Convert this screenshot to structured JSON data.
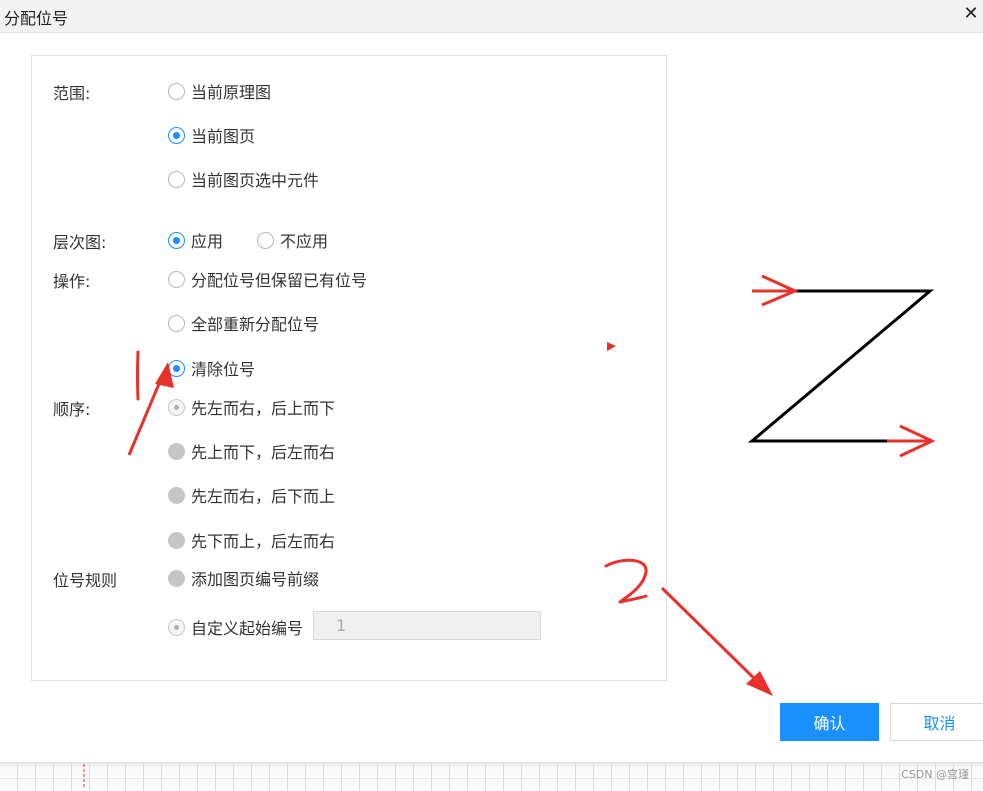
{
  "dialog": {
    "title": "分配位号",
    "close_glyph": "✕"
  },
  "scope": {
    "label": "范围:",
    "options": [
      "当前原理图",
      "当前图页",
      "当前图页选中元件"
    ],
    "selected": 1
  },
  "hierarchy": {
    "label": "层次图:",
    "options": [
      "应用",
      "不应用"
    ],
    "selected": 0
  },
  "operation": {
    "label": "操作:",
    "options": [
      "分配位号但保留已有位号",
      "全部重新分配位号",
      "清除位号"
    ],
    "selected": 2
  },
  "order": {
    "label": "顺序:",
    "options": [
      "先左而右，后上而下",
      "先上而下，后左而右",
      "先左而右，后下而上",
      "先下而上，后左而右"
    ],
    "selected": 0,
    "disabled": true
  },
  "rule": {
    "label": "位号规则",
    "prefix_option": "添加图页编号前缀",
    "custom_start_option": "自定义起始编号",
    "start_value": "1"
  },
  "buttons": {
    "confirm": "确认",
    "cancel": "取消"
  },
  "watermark": "CSDN @宫瑾",
  "colors": {
    "accent": "#1890ff",
    "annotation": "#e8312a",
    "titlebar": "#f2f2f2"
  }
}
